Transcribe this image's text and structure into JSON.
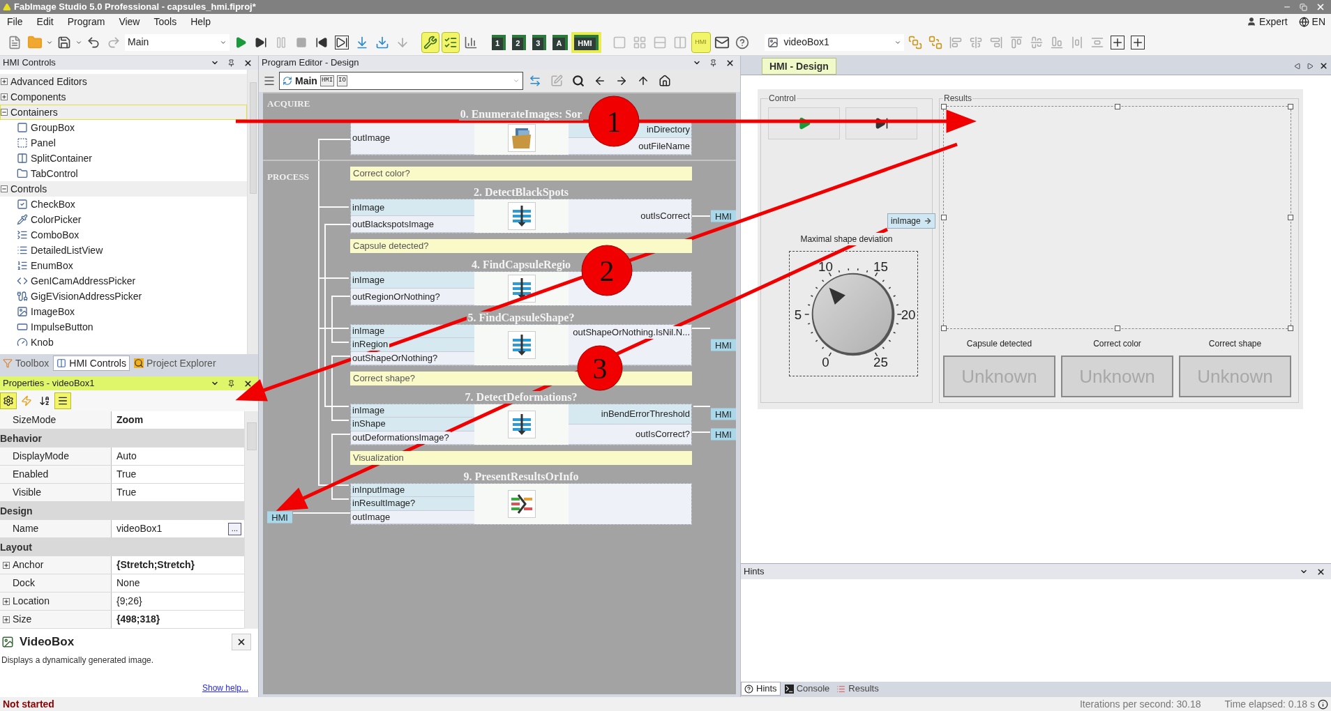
{
  "window": {
    "title": "FabImage Studio 5.0 Professional - capsules_hmi.fiproj*"
  },
  "menu": [
    "File",
    "Edit",
    "Program",
    "View",
    "Tools",
    "Help"
  ],
  "user": {
    "role": "Expert",
    "language": "EN"
  },
  "toolbar": {
    "program_select": "Main",
    "tools": [
      {
        "kind": "wrench",
        "on": true
      },
      {
        "kind": "list",
        "on": true
      },
      {
        "kind": "chart",
        "on": false
      }
    ],
    "layouts": [
      {
        "label": "1",
        "selected": false
      },
      {
        "label": "2",
        "selected": false
      },
      {
        "label": "3",
        "selected": false
      },
      {
        "label": "A",
        "selected": false
      },
      {
        "label": "HMI",
        "selected": true
      }
    ],
    "hmi_toggle": {
      "label": "HMI",
      "on": true
    },
    "control_select": "videoBox1"
  },
  "hmi_controls_panel": {
    "title": "HMI Controls",
    "tree": [
      {
        "label": "Advanced Editors",
        "expanded": false,
        "selected": false
      },
      {
        "label": "Components",
        "expanded": false,
        "selected": false
      },
      {
        "label": "Containers",
        "expanded": true,
        "selected": true,
        "children": [
          {
            "label": "GroupBox",
            "selected": false
          },
          {
            "label": "Panel",
            "selected": false
          },
          {
            "label": "SplitContainer",
            "selected": false
          },
          {
            "label": "TabControl",
            "selected": false
          }
        ]
      },
      {
        "label": "Controls",
        "expanded": true,
        "selected": false,
        "children": [
          {
            "label": "CheckBox",
            "selected": false
          },
          {
            "label": "ColorPicker",
            "selected": false
          },
          {
            "label": "ComboBox",
            "selected": false
          },
          {
            "label": "DetailedListView",
            "selected": false
          },
          {
            "label": "EnumBox",
            "selected": false
          },
          {
            "label": "GenICamAddressPicker",
            "selected": false
          },
          {
            "label": "GigEVisionAddressPicker",
            "selected": false
          },
          {
            "label": "ImageBox",
            "selected": false
          },
          {
            "label": "ImpulseButton",
            "selected": false
          },
          {
            "label": "Knob",
            "selected": false
          }
        ]
      }
    ]
  },
  "left_tabs": [
    {
      "label": "Toolbox",
      "selected": false
    },
    {
      "label": "HMI Controls",
      "selected": true
    },
    {
      "label": "Project Explorer",
      "selected": false
    }
  ],
  "properties": {
    "title": "Properties - videoBox1",
    "view_buttons": [
      {
        "kind": "properties",
        "selected": true
      },
      {
        "kind": "events",
        "selected": false
      },
      {
        "kind": "alphabetical",
        "selected": false
      },
      {
        "kind": "categorized",
        "selected": true
      }
    ],
    "rows": [
      {
        "kind": "property",
        "name": "SizeMode",
        "value": "Zoom",
        "modified": true,
        "expandable": false
      },
      {
        "kind": "category",
        "name": "Behavior"
      },
      {
        "kind": "property",
        "name": "DisplayMode",
        "value": "Auto",
        "modified": false,
        "expandable": false
      },
      {
        "kind": "property",
        "name": "Enabled",
        "value": "True",
        "modified": false,
        "expandable": false
      },
      {
        "kind": "property",
        "name": "Visible",
        "value": "True",
        "modified": false,
        "expandable": false
      },
      {
        "kind": "category",
        "name": "Design"
      },
      {
        "kind": "property",
        "name": "Name",
        "value": "videoBox1",
        "modified": false,
        "expandable": false,
        "button": "..."
      },
      {
        "kind": "category",
        "name": "Layout"
      },
      {
        "kind": "property",
        "name": "Anchor",
        "value": "{Stretch;Stretch}",
        "modified": true,
        "expandable": true
      },
      {
        "kind": "property",
        "name": "Dock",
        "value": "None",
        "modified": false,
        "expandable": false
      },
      {
        "kind": "property",
        "name": "Location",
        "value": "{9;26}",
        "modified": false,
        "expandable": true
      },
      {
        "kind": "property",
        "name": "Size",
        "value": "{498;318}",
        "modified": true,
        "expandable": true
      }
    ],
    "help": {
      "title": "VideoBox",
      "text": "Displays a dynamically generated image.",
      "link": "Show help..."
    }
  },
  "program_editor": {
    "title": "Program Editor - Design",
    "path": "Main",
    "badges": [
      "HMI",
      "IO"
    ],
    "sections": [
      {
        "label": "ACQUIRE",
        "items": [
          {
            "kind": "source",
            "title": "0. EnumerateImages: Sor",
            "left": [
              {
                "label": "outImage",
                "kind": "out"
              }
            ],
            "right": [
              {
                "label": "inDirectory",
                "kind": "in"
              },
              {
                "label": "outFileName",
                "kind": "out"
              }
            ]
          }
        ]
      },
      {
        "label": "PROCESS",
        "items": [
          {
            "kind": "comment",
            "text": "Correct color?"
          },
          {
            "kind": "filter",
            "title": "2. DetectBlackSpots",
            "left": [
              {
                "label": "inImage",
                "kind": "in"
              },
              {
                "label": "outBlackspotsImage",
                "kind": "out"
              }
            ],
            "right": [
              {
                "label": "outIsCorrect",
                "kind": "out",
                "hmi": "HMI"
              }
            ]
          },
          {
            "kind": "comment",
            "text": "Capsule detected?"
          },
          {
            "kind": "filter",
            "title": "4. FindCapsuleRegio",
            "left": [
              {
                "label": "inImage",
                "kind": "in"
              },
              {
                "label": "outRegionOrNothing?",
                "kind": "out"
              }
            ]
          },
          {
            "kind": "filter",
            "title": "5. FindCapsuleShape?",
            "left": [
              {
                "label": "inImage",
                "kind": "in"
              },
              {
                "label": "inRegion",
                "kind": "in"
              },
              {
                "label": "outShapeOrNothing?",
                "kind": "out"
              }
            ],
            "right": [
              {
                "label": "outShapeOrNothing.IsNil.N...",
                "kind": "out",
                "hmi": "HMI"
              }
            ]
          },
          {
            "kind": "comment",
            "text": "Correct shape?"
          },
          {
            "kind": "filter",
            "title": "7. DetectDeformations?",
            "left": [
              {
                "label": "inImage",
                "kind": "in"
              },
              {
                "label": "inShape",
                "kind": "in"
              },
              {
                "label": "outDeformationsImage?",
                "kind": "out"
              }
            ],
            "right": [
              {
                "label": "inBendErrorThreshold",
                "kind": "in",
                "hmi": "HMI"
              },
              {
                "label": "outIsCorrect?",
                "kind": "out",
                "hmi": "HMI"
              }
            ]
          },
          {
            "kind": "comment",
            "text": "Visualization"
          },
          {
            "kind": "merge",
            "title": "9. PresentResultsOrInfo",
            "left": [
              {
                "label": "inInputImage",
                "kind": "in"
              },
              {
                "label": "inResultImage?",
                "kind": "in"
              },
              {
                "label": "outImage",
                "kind": "out",
                "hmi": "HMI"
              }
            ]
          }
        ]
      }
    ]
  },
  "hmi_design": {
    "tab": "HMI - Design",
    "control_group": "Control",
    "port_tag": "inImage",
    "knob_label": "Maximal shape deviation",
    "knob": {
      "level": 0.36,
      "labels": [
        "0",
        "5",
        "10",
        "15",
        "20",
        "25"
      ]
    },
    "results_group": "Results",
    "indicators": [
      {
        "label": "Capsule detected",
        "value": "Unknown"
      },
      {
        "label": "Correct color",
        "value": "Unknown"
      },
      {
        "label": "Correct shape",
        "value": "Unknown"
      }
    ]
  },
  "hints": {
    "title": "Hints"
  },
  "bottom_tabs": [
    {
      "label": "Hints",
      "selected": true
    },
    {
      "label": "Console",
      "selected": false
    },
    {
      "label": "Results",
      "selected": false
    }
  ],
  "status": {
    "state": "Not started",
    "iterations": "Iterations per second: 30.18",
    "elapsed": "Time elapsed: 0.18 s"
  },
  "callouts": [
    {
      "label": "1"
    },
    {
      "label": "2"
    },
    {
      "label": "3"
    }
  ]
}
